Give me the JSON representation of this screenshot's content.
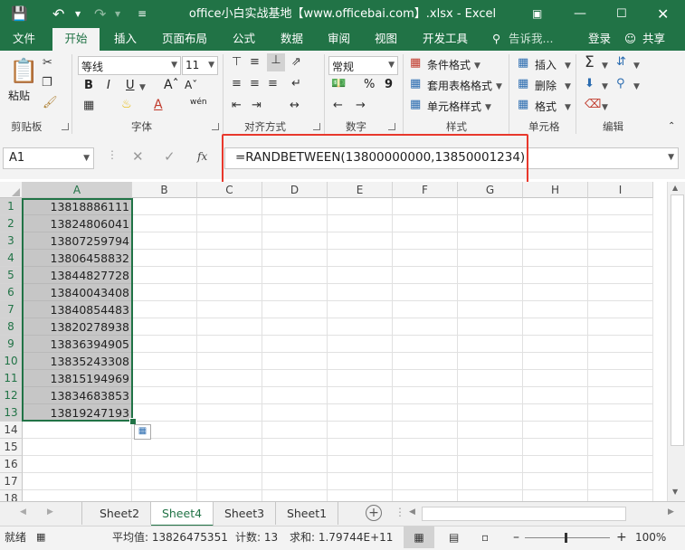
{
  "window": {
    "title": "office小白实战基地【www.officebai.com】.xlsx - Excel",
    "title_color": "#217346"
  },
  "ribbon_tabs": [
    "文件",
    "开始",
    "插入",
    "页面布局",
    "公式",
    "数据",
    "审阅",
    "视图",
    "开发工具"
  ],
  "ribbon_tab_active": "开始",
  "tell_me": "告诉我...",
  "login": "登录",
  "share": "共享",
  "clipboard": {
    "paste": "粘贴",
    "label": "剪贴板"
  },
  "font": {
    "name": "等线",
    "size": "11",
    "label": "字体",
    "bold": "B",
    "italic": "I",
    "underline": "U",
    "wen": "wén"
  },
  "alignment": {
    "label": "对齐方式"
  },
  "number": {
    "format": "常规",
    "label": "数字",
    "percent": "%",
    "comma": "9"
  },
  "styles": {
    "conditional": "条件格式",
    "table": "套用表格格式",
    "cell": "单元格样式",
    "label": "样式"
  },
  "cells": {
    "insert": "插入",
    "delete": "删除",
    "format": "格式",
    "label": "单元格"
  },
  "editing": {
    "label": "编辑"
  },
  "formula_bar": {
    "name_box": "A1",
    "fx": "fx",
    "formula": "=RANDBETWEEN(13800000000,13850001234)",
    "highlight_color": "#e8382c"
  },
  "columns": [
    "A",
    "B",
    "C",
    "D",
    "E",
    "F",
    "G",
    "H",
    "I"
  ],
  "rows": [
    "1",
    "2",
    "3",
    "4",
    "5",
    "6",
    "7",
    "8",
    "9",
    "10",
    "11",
    "12",
    "13",
    "14",
    "15",
    "16",
    "17",
    "18"
  ],
  "column_a_values": [
    "13818886111",
    "13824806041",
    "13807259794",
    "13806458832",
    "13844827728",
    "13840043408",
    "13840854483",
    "13820278938",
    "13836394905",
    "13835243308",
    "13815194969",
    "13834683853",
    "13819247193"
  ],
  "sheets": [
    "Sheet2",
    "Sheet4",
    "Sheet3",
    "Sheet1"
  ],
  "active_sheet": "Sheet4",
  "status": {
    "mode": "就绪",
    "average": "平均值: 13826475351",
    "count": "计数: 13",
    "sum": "求和: 1.79744E+11",
    "zoom": "100%"
  }
}
